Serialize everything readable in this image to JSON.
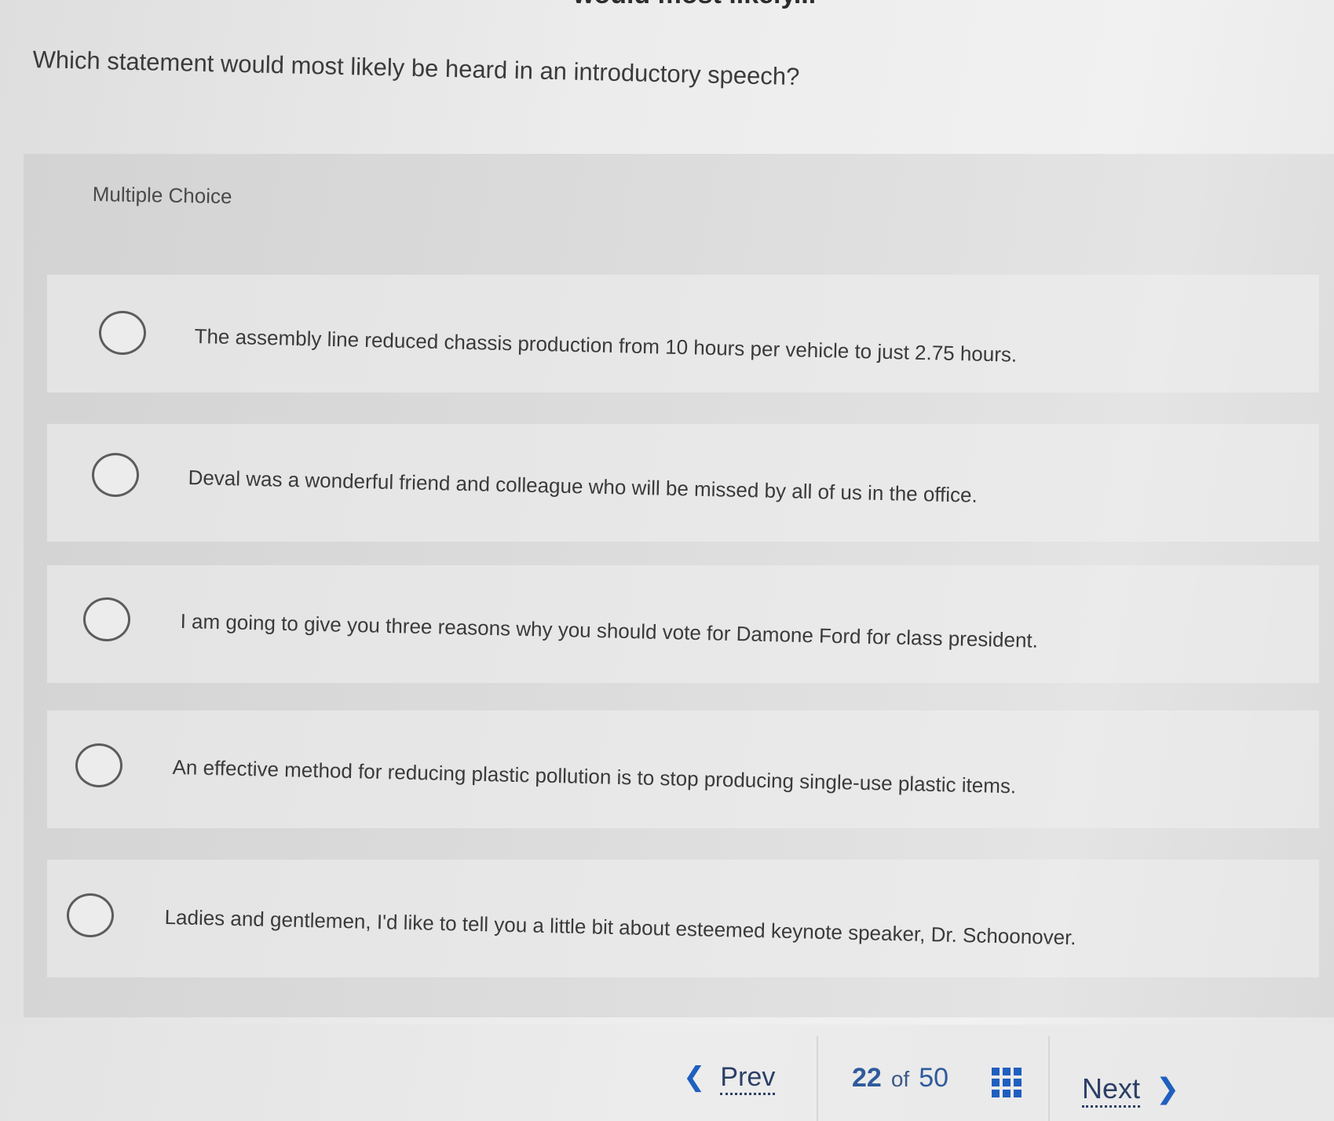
{
  "header": {
    "cut_title": "would most likely..."
  },
  "question": "Which statement would most likely be heard in an introductory speech?",
  "question_type": "Multiple Choice",
  "options": [
    {
      "text": "The assembly line reduced chassis production from 10 hours per vehicle to just 2.75 hours.",
      "selected": false
    },
    {
      "text": "Deval was a wonderful friend and colleague who will be missed by all of us in the office.",
      "selected": false
    },
    {
      "text": "I am going to give you three reasons why you should vote for Damone Ford for class president.",
      "selected": false
    },
    {
      "text": "An effective method for reducing plastic pollution is to stop producing single-use plastic items.",
      "selected": false
    },
    {
      "text": "Ladies and gentlemen, I'd like to tell you a little bit about esteemed keynote speaker, Dr. Schoonover.",
      "selected": false
    }
  ],
  "navigation": {
    "prev_label": "Prev",
    "next_label": "Next",
    "current": "22",
    "of_label": "of",
    "total": "50",
    "prev_icon": "chevron-left-icon",
    "next_icon": "chevron-right-icon",
    "grid_icon": "question-grid-icon"
  },
  "colors": {
    "accent": "#1f5fbf",
    "link_text": "#2c3f66"
  }
}
